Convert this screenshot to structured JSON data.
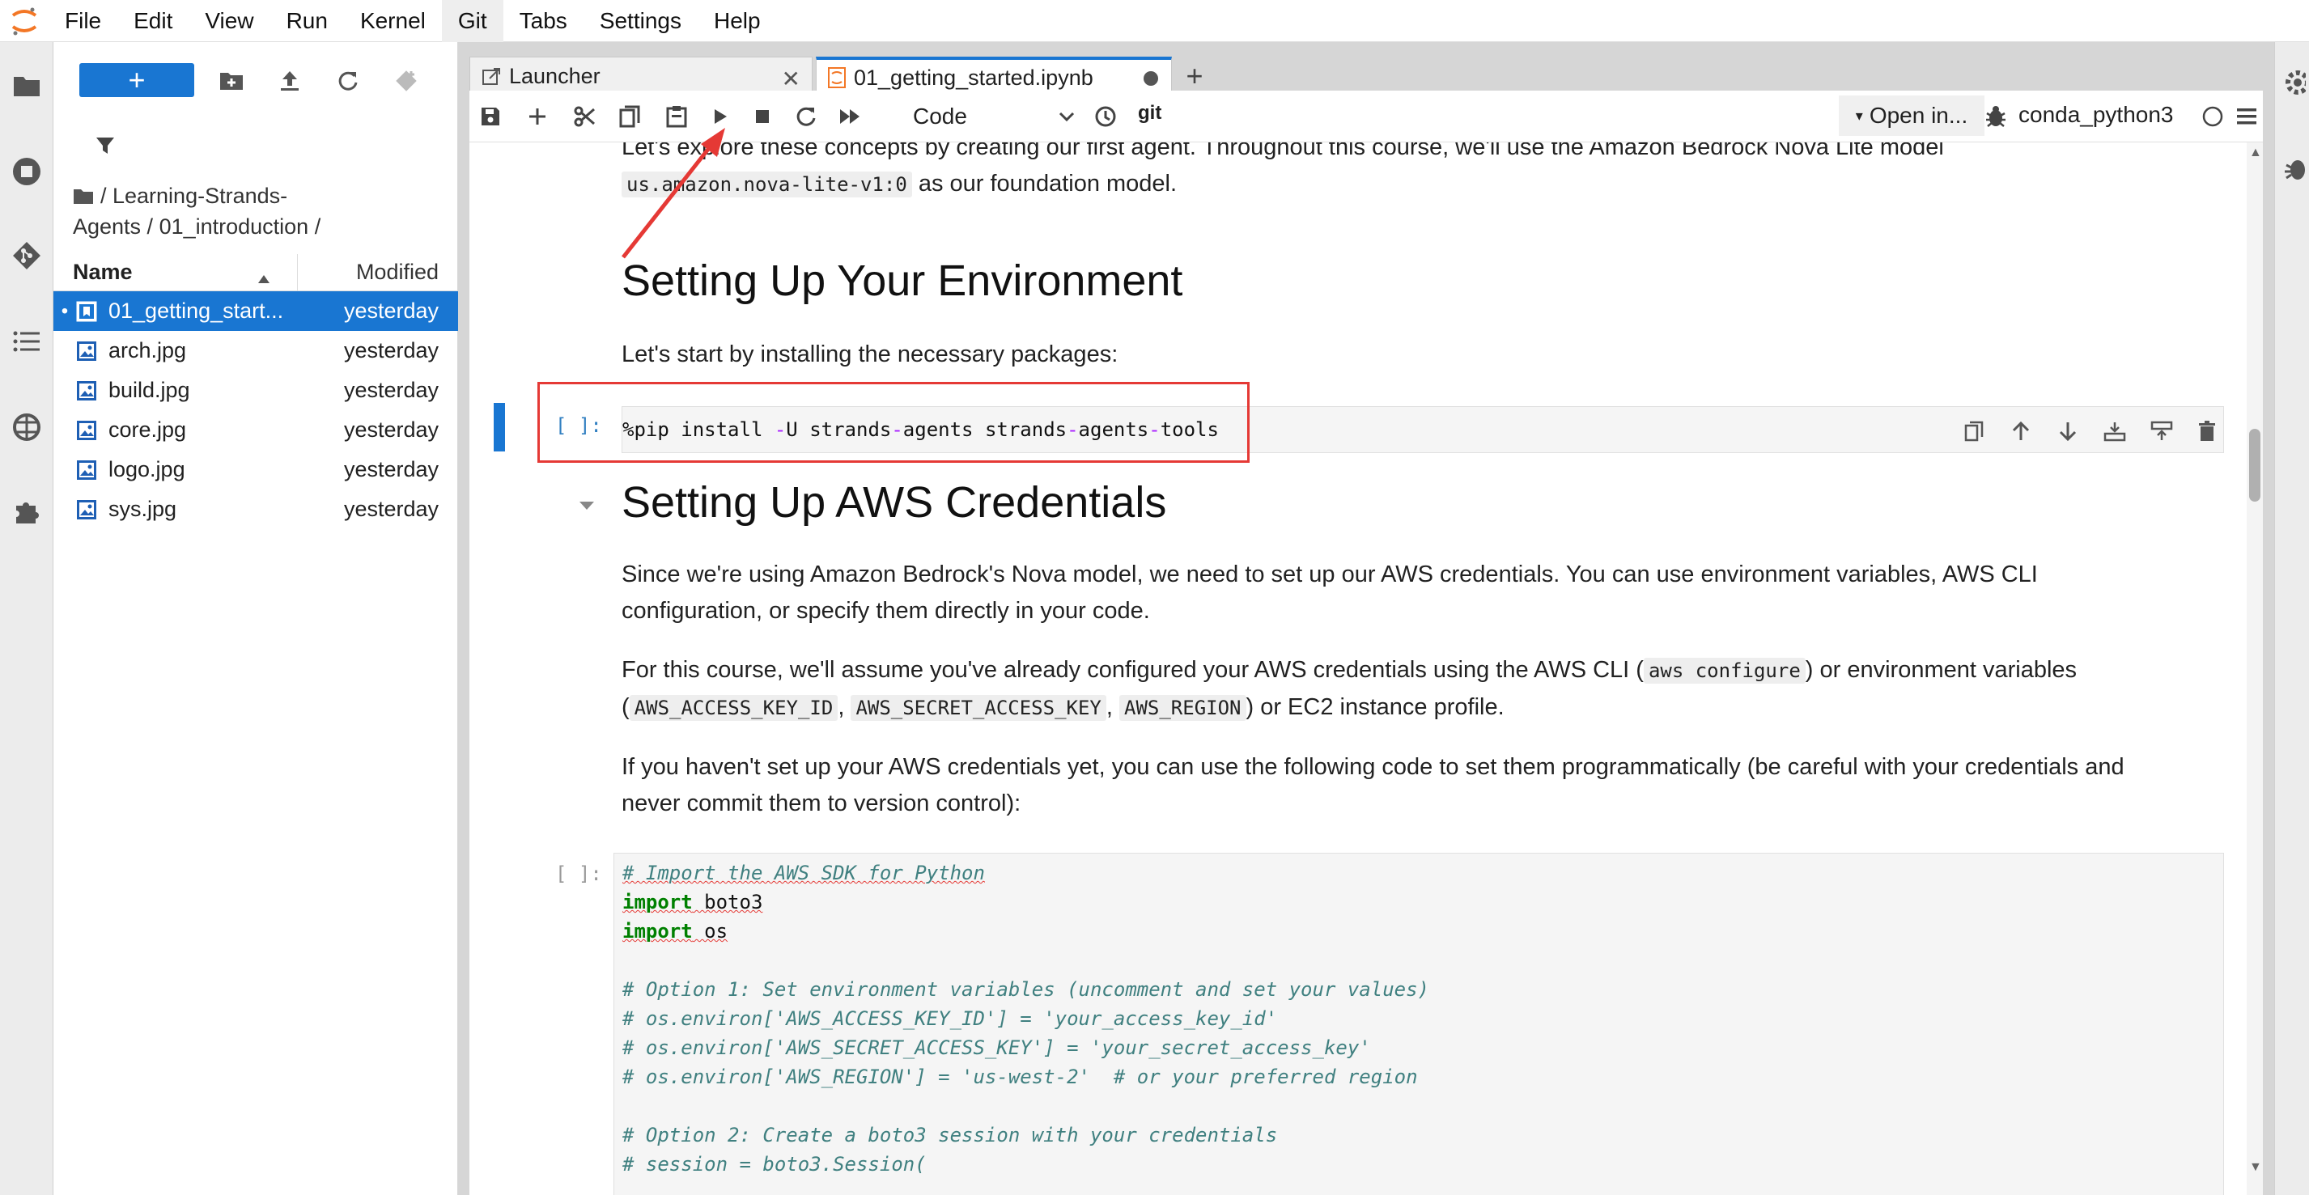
{
  "menubar": {
    "items": [
      "File",
      "Edit",
      "View",
      "Run",
      "Kernel",
      "Git",
      "Tabs",
      "Settings",
      "Help"
    ]
  },
  "file_browser": {
    "new_label": "+",
    "breadcrumb": "/ Learning-Strands-Agents / 01_introduction /",
    "header": {
      "name": "Name",
      "modified": "Modified"
    },
    "files": [
      {
        "name": "01_getting_start...",
        "modified": "yesterday",
        "icon": "notebook-icon",
        "selected": true
      },
      {
        "name": "arch.jpg",
        "modified": "yesterday",
        "icon": "image-icon"
      },
      {
        "name": "build.jpg",
        "modified": "yesterday",
        "icon": "image-icon"
      },
      {
        "name": "core.jpg",
        "modified": "yesterday",
        "icon": "image-icon"
      },
      {
        "name": "logo.jpg",
        "modified": "yesterday",
        "icon": "image-icon"
      },
      {
        "name": "sys.jpg",
        "modified": "yesterday",
        "icon": "image-icon"
      }
    ]
  },
  "tabs": [
    {
      "label": "Launcher"
    },
    {
      "label": "01_getting_started.ipynb"
    }
  ],
  "toolbar": {
    "cell_type": "Code",
    "git_label": "git",
    "open_in": "Open in...",
    "kernel": "conda_python3"
  },
  "notebook": {
    "intro_line1": "Let's explore these concepts by creating our first agent. Throughout this course, we'll use the Amazon Bedrock Nova Lite model",
    "intro_code": "us.amazon.nova-lite-v1:0",
    "intro_line2_end": " as our foundation model.",
    "heading1": "Setting Up Your Environment",
    "para1": "Let's start by installing the necessary packages:",
    "cell1_prompt": "[ ]:",
    "cell1_code": {
      "a": "%pip install ",
      "b": "-",
      "c": "U strands",
      "d": "-",
      "e": "agents strands",
      "f": "-",
      "g": "agents",
      "h": "-",
      "i": "tools"
    },
    "heading2": "Setting Up AWS Credentials",
    "para2": "Since we're using Amazon Bedrock's Nova model, we need to set up our AWS credentials. You can use environment variables, AWS CLI configuration, or specify them directly in your code.",
    "para3_a": "For this course, we'll assume you've already configured your AWS credentials using the AWS CLI (",
    "para3_code1": "aws configure",
    "para3_b": ") or environment variables",
    "para3_code2": "AWS_ACCESS_KEY_ID",
    "para3_code3": "AWS_SECRET_ACCESS_KEY",
    "para3_code4": "AWS_REGION",
    "para3_c": ") or EC2 instance profile.",
    "para4": "If you haven't set up your AWS credentials yet, you can use the following code to set them programmatically (be careful with your credentials and never commit them to version control):",
    "cell2_prompt": "[ ]:",
    "cell2": {
      "l1": "# Import the AWS SDK for Python",
      "l2_kw": "import",
      "l2_mod": " boto3",
      "l3_kw": "import",
      "l3_mod": " os",
      "l5": "# Option 1: Set environment variables (uncomment and set your values)",
      "l6": "# os.environ['AWS_ACCESS_KEY_ID'] = 'your_access_key_id'",
      "l7": "# os.environ['AWS_SECRET_ACCESS_KEY'] = 'your_secret_access_key'",
      "l8": "# os.environ['AWS_REGION'] = 'us-west-2'  # or your preferred region",
      "l10": "# Option 2: Create a boto3 session with your credentials",
      "l11": "# session = boto3.Session("
    }
  },
  "colors": {
    "accent": "#1976d2",
    "annotation_red": "#e53935"
  }
}
